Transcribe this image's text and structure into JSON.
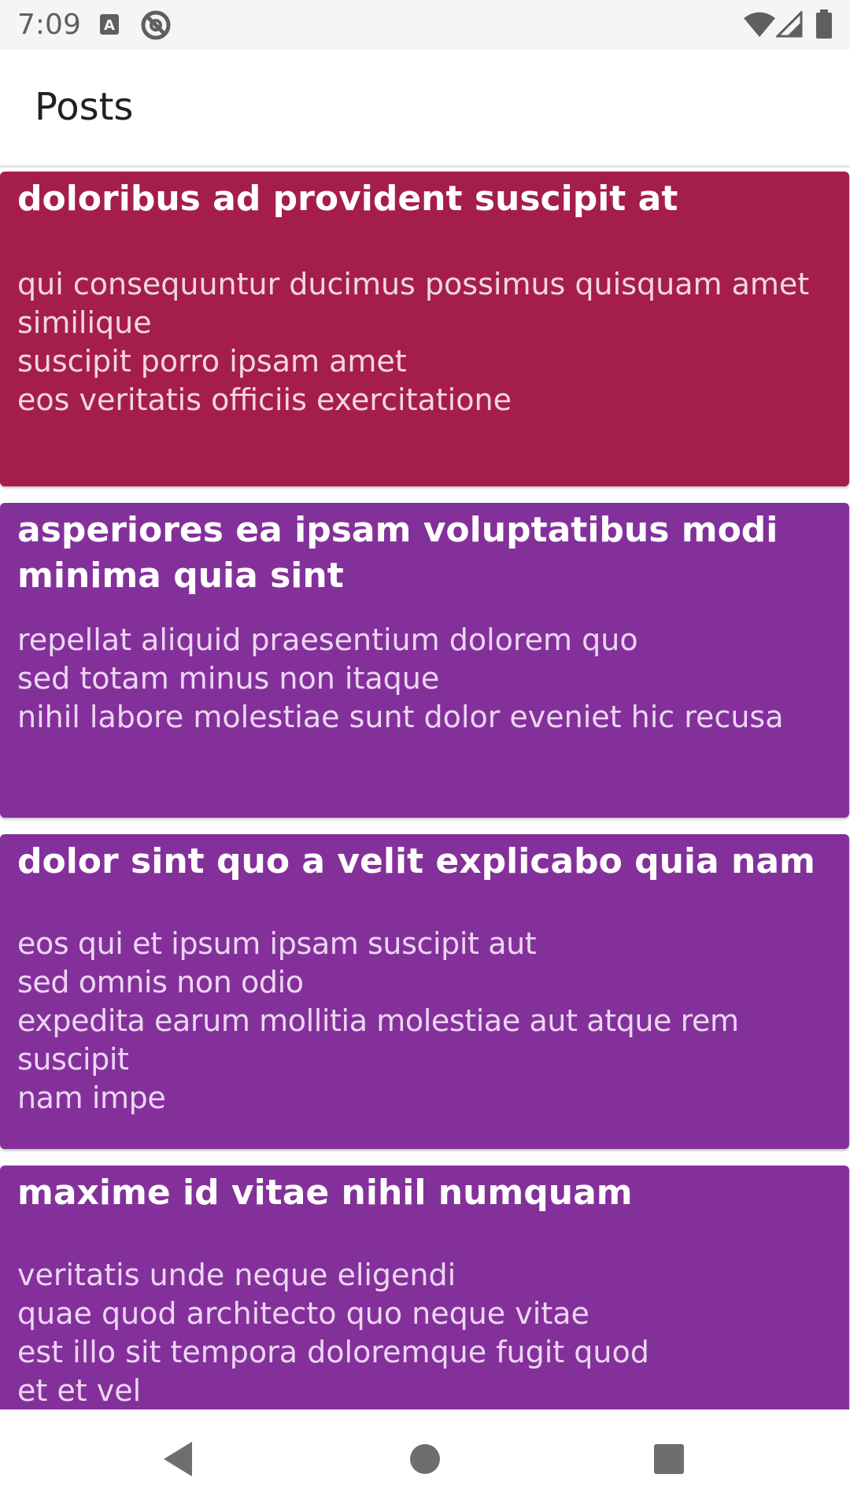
{
  "status_bar": {
    "time": "7:09",
    "icons_left": [
      "font-a-icon",
      "at-sign-icon"
    ],
    "icons_right": [
      "wifi-icon",
      "cell-signal-icon",
      "battery-icon"
    ]
  },
  "app_bar": {
    "title": "Posts"
  },
  "colors": {
    "first_card": "#a51e4a",
    "other_cards": "#84309b",
    "status_bar_bg": "#f5f5f5",
    "nav_icon": "#6e6e6e"
  },
  "posts": [
    {
      "title": "doloribus ad provident suscipit at",
      "body": "qui consequuntur ducimus possimus quisquam amet similique\nsuscipit porro ipsam amet\neos veritatis officiis exercitatione"
    },
    {
      "title": "asperiores ea ipsam voluptatibus modi minima quia sint",
      "body": "repellat aliquid praesentium dolorem quo\nsed totam minus non itaque\nnihil labore molestiae sunt dolor eveniet hic recusa"
    },
    {
      "title": "dolor sint quo a velit explicabo quia nam",
      "body": "eos qui et ipsum ipsam suscipit aut\nsed omnis non odio\nexpedita earum mollitia molestiae aut atque rem suscipit\nnam impe"
    },
    {
      "title": "maxime id vitae nihil numquam",
      "body": "veritatis unde neque eligendi\nquae quod architecto quo neque vitae\nest illo sit tempora doloremque fugit quod\net et vel"
    }
  ],
  "nav_bar": {
    "buttons": [
      "back-icon",
      "home-icon",
      "recents-icon"
    ]
  }
}
